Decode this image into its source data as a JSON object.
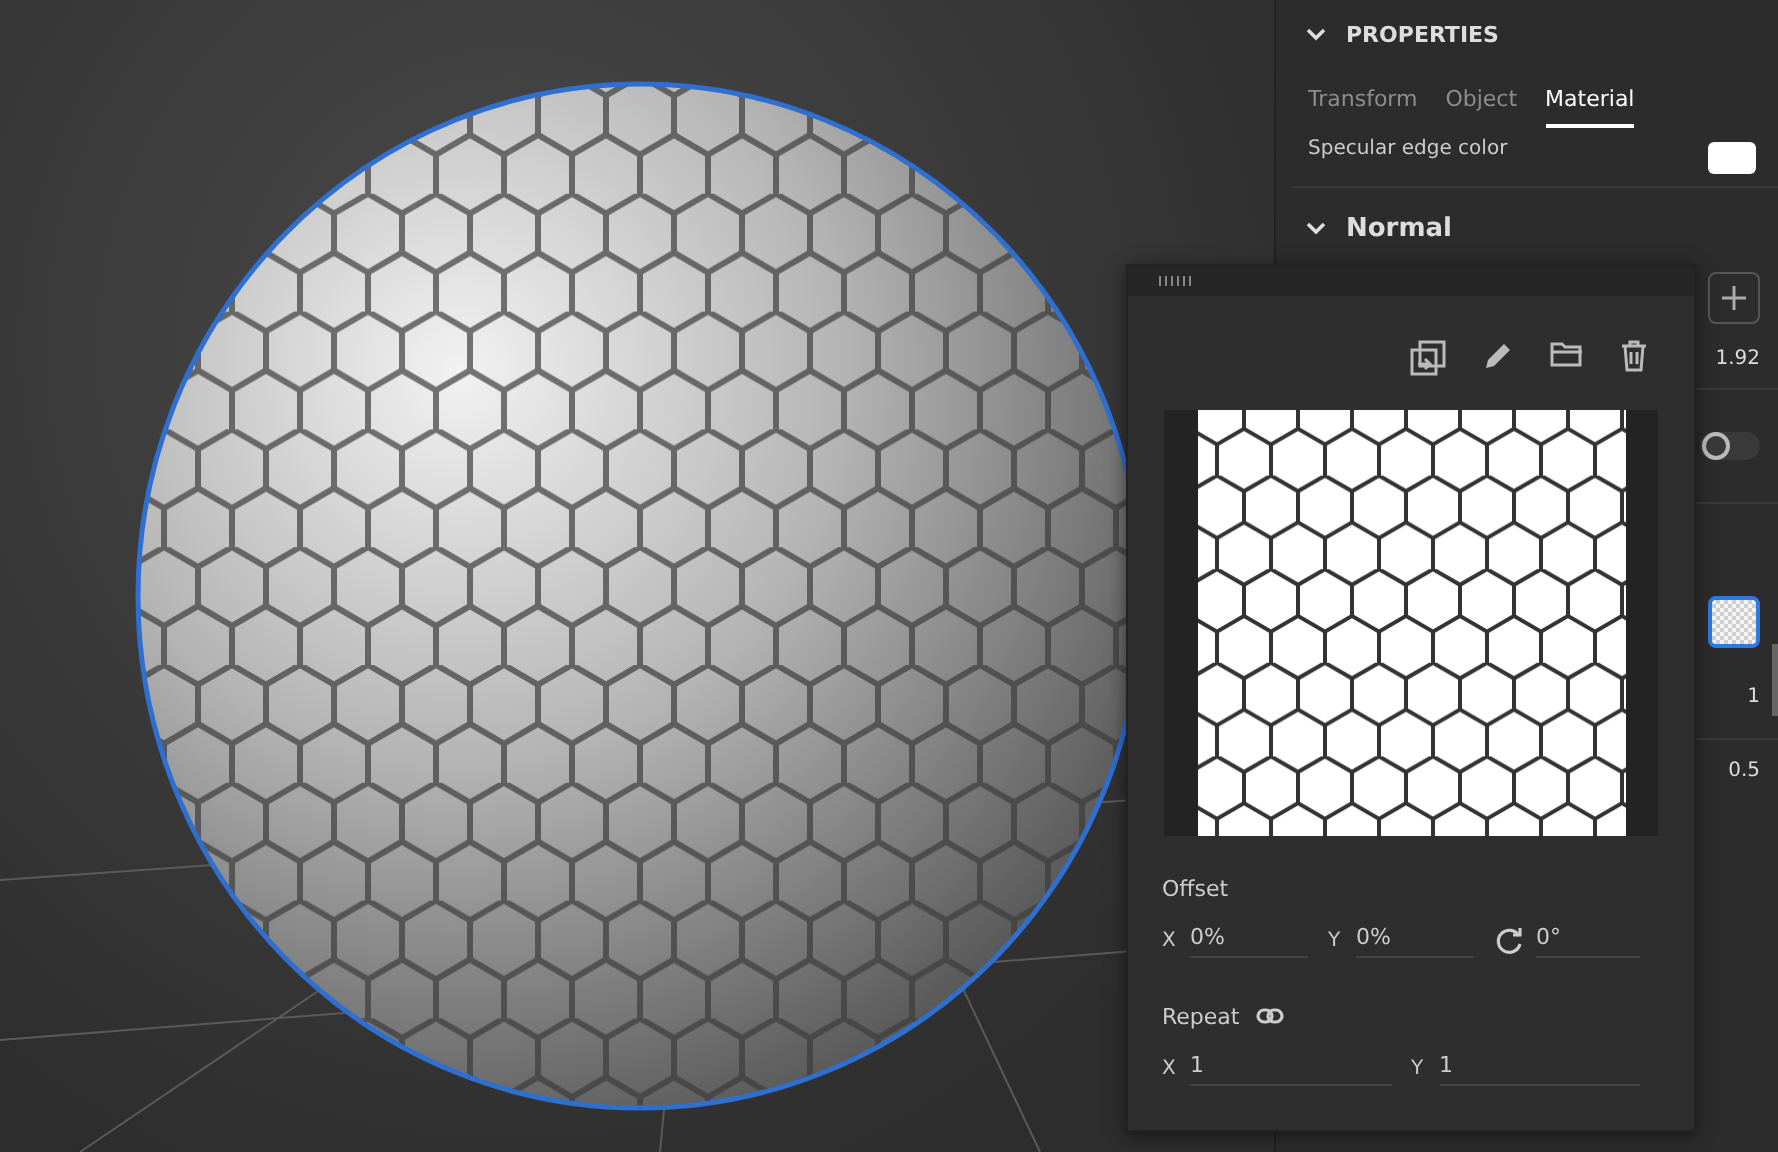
{
  "properties": {
    "title": "PROPERTIES",
    "expanded": true
  },
  "tabs": [
    {
      "label": "Transform",
      "selected": false
    },
    {
      "label": "Object",
      "selected": false
    },
    {
      "label": "Material",
      "selected": true
    }
  ],
  "specular_edge_color": {
    "label": "Specular edge color"
  },
  "normal": {
    "title": "Normal",
    "expanded": true
  },
  "panel_rows": [
    {
      "kind": "add"
    },
    {
      "kind": "value",
      "value": "1.92"
    },
    {
      "kind": "toggle",
      "on": false
    },
    {
      "kind": "swatch",
      "selected": true
    },
    {
      "kind": "value",
      "value": "1"
    },
    {
      "kind": "value",
      "value": "0.5"
    }
  ],
  "texture_popup": {
    "offset": {
      "label": "Offset",
      "fields": [
        {
          "kind": "axis",
          "axis": "X",
          "value": "0%"
        },
        {
          "kind": "axis",
          "axis": "Y",
          "value": "0%"
        },
        {
          "kind": "rotation",
          "value": "0°"
        }
      ]
    },
    "repeat": {
      "label": "Repeat",
      "fields": [
        {
          "kind": "axis",
          "axis": "X",
          "value": "1"
        },
        {
          "kind": "axis",
          "axis": "Y",
          "value": "1"
        }
      ]
    }
  }
}
